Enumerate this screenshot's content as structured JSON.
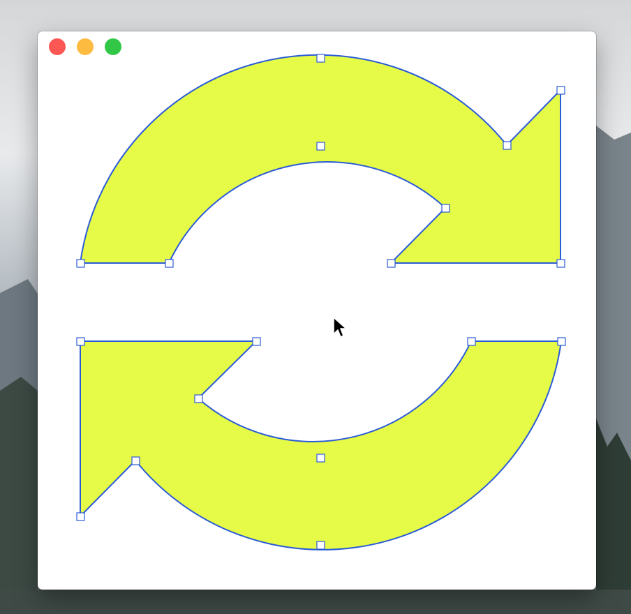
{
  "window": {
    "title": "",
    "traffic_lights": {
      "close": "#fc5753",
      "minimize": "#fdbc40",
      "zoom": "#33c748"
    }
  },
  "canvas": {
    "shape_fill": "#e6fb47",
    "stroke_color": "#2a5bd7",
    "handle_fill": "#ffffff",
    "handle_stroke": "#2a5bd7",
    "shapes": [
      "top-arrow",
      "bottom-arrow"
    ]
  },
  "cursor": {
    "icon": "arrow-pointer-icon"
  },
  "background": {
    "description_icon": "mountain-forest-wallpaper"
  }
}
